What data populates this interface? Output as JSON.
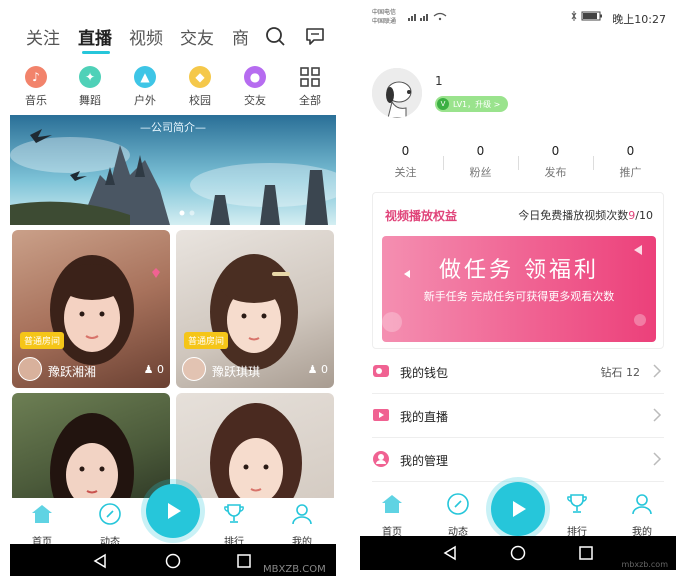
{
  "left": {
    "tabs": [
      "关注",
      "直播",
      "视频",
      "交友",
      "商"
    ],
    "categories": [
      {
        "label": "音乐",
        "color": "#f2836b"
      },
      {
        "label": "舞蹈",
        "color": "#4fd1b8"
      },
      {
        "label": "户外",
        "color": "#3ec5e6"
      },
      {
        "label": "校园",
        "color": "#f5c84a"
      },
      {
        "label": "交友",
        "color": "#b66cf0"
      },
      {
        "label": "全部",
        "color": "#555555"
      }
    ],
    "banner_title": "—公司简介—",
    "cards": [
      {
        "badge": "普通房间",
        "name": "豫跃湘湘",
        "viewers": "0"
      },
      {
        "badge": "普通房间",
        "name": "豫跃琪琪",
        "viewers": "0"
      },
      {
        "badge": "",
        "name": "",
        "viewers": ""
      },
      {
        "badge": "",
        "name": "",
        "viewers": ""
      }
    ],
    "nav": {
      "home": "首页",
      "feed": "动态",
      "rank": "排行",
      "mine": "我的"
    },
    "watermark": "MBXZB.COM"
  },
  "right": {
    "status": {
      "carrier1": "中国电信",
      "carrier2": "中国联通",
      "time": "晚上10:27"
    },
    "username": "1",
    "level": {
      "badge": "V",
      "text": "LV1，升级 >"
    },
    "stats": [
      {
        "value": "0",
        "label": "关注"
      },
      {
        "value": "0",
        "label": "粉丝"
      },
      {
        "value": "0",
        "label": "发布"
      },
      {
        "value": "0",
        "label": "推广"
      }
    ],
    "rights": {
      "title": "视频播放权益",
      "count_prefix": "今日免费播放视频次数",
      "count_used": "9",
      "count_total": "/10",
      "promo_title": "做任务 领福利",
      "promo_sub": "新手任务  完成任务可获得更多观看次数"
    },
    "menu": [
      {
        "label": "我的钱包",
        "value": "钻石 12"
      },
      {
        "label": "我的直播",
        "value": ""
      },
      {
        "label": "我的管理",
        "value": ""
      }
    ],
    "nav": {
      "home": "首页",
      "feed": "动态",
      "rank": "排行",
      "mine": "我的"
    },
    "watermark": "mbxzb.com"
  },
  "colors": {
    "accent": "#26c6da",
    "pink": "#e0447a"
  }
}
